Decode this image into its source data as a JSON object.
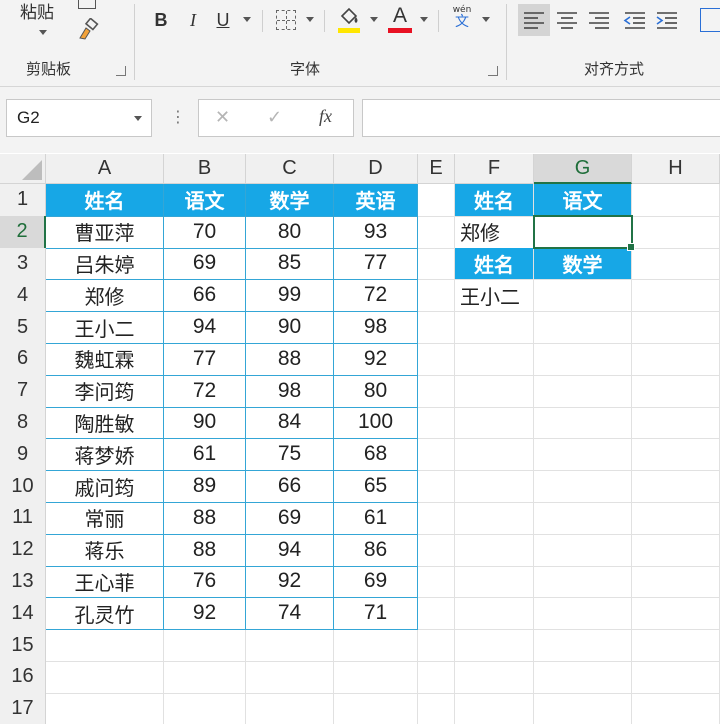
{
  "ribbon": {
    "clipboard": {
      "paste_label": "粘贴",
      "group_label": "剪贴板"
    },
    "font": {
      "group_label": "字体",
      "bold": "B",
      "italic": "I",
      "underline": "U",
      "font_color_letter": "A",
      "phonetic_top": "wén",
      "phonetic_bottom": "文",
      "fill_color": "#ffe600",
      "font_color": "#e81123"
    },
    "alignment": {
      "group_label": "对齐方式"
    }
  },
  "formula_bar": {
    "name_box": "G2",
    "colon": "⋮",
    "cancel": "✕",
    "enter": "✓",
    "fx": "fx",
    "formula": ""
  },
  "sheet": {
    "columns": [
      "A",
      "B",
      "C",
      "D",
      "E",
      "F",
      "G",
      "H"
    ],
    "rows": [
      "1",
      "2",
      "3",
      "4",
      "5",
      "6",
      "7",
      "8",
      "9",
      "10",
      "11",
      "12",
      "13",
      "14",
      "15",
      "16",
      "17"
    ],
    "main_headers": [
      "姓名",
      "语文",
      "数学",
      "英语"
    ],
    "main_rows": [
      [
        "曹亚萍",
        "70",
        "80",
        "93"
      ],
      [
        "吕朱婷",
        "69",
        "85",
        "77"
      ],
      [
        "郑修",
        "66",
        "99",
        "72"
      ],
      [
        "王小二",
        "94",
        "90",
        "98"
      ],
      [
        "魏虹霖",
        "77",
        "88",
        "92"
      ],
      [
        "李问筠",
        "72",
        "98",
        "80"
      ],
      [
        "陶胜敏",
        "90",
        "84",
        "100"
      ],
      [
        "蒋梦娇",
        "61",
        "75",
        "68"
      ],
      [
        "戚问筠",
        "89",
        "66",
        "65"
      ],
      [
        "常丽",
        "88",
        "69",
        "61"
      ],
      [
        "蒋乐",
        "88",
        "94",
        "86"
      ],
      [
        "王心菲",
        "76",
        "92",
        "69"
      ],
      [
        "孔灵竹",
        "92",
        "74",
        "71"
      ]
    ],
    "lookup1": {
      "header_name": "姓名",
      "header_subject": "语文",
      "name": "郑修",
      "result": ""
    },
    "lookup2": {
      "header_name": "姓名",
      "header_subject": "数学",
      "name": "王小二",
      "result": ""
    },
    "header_fill": "#17a7e6",
    "active_cell": "G2"
  }
}
